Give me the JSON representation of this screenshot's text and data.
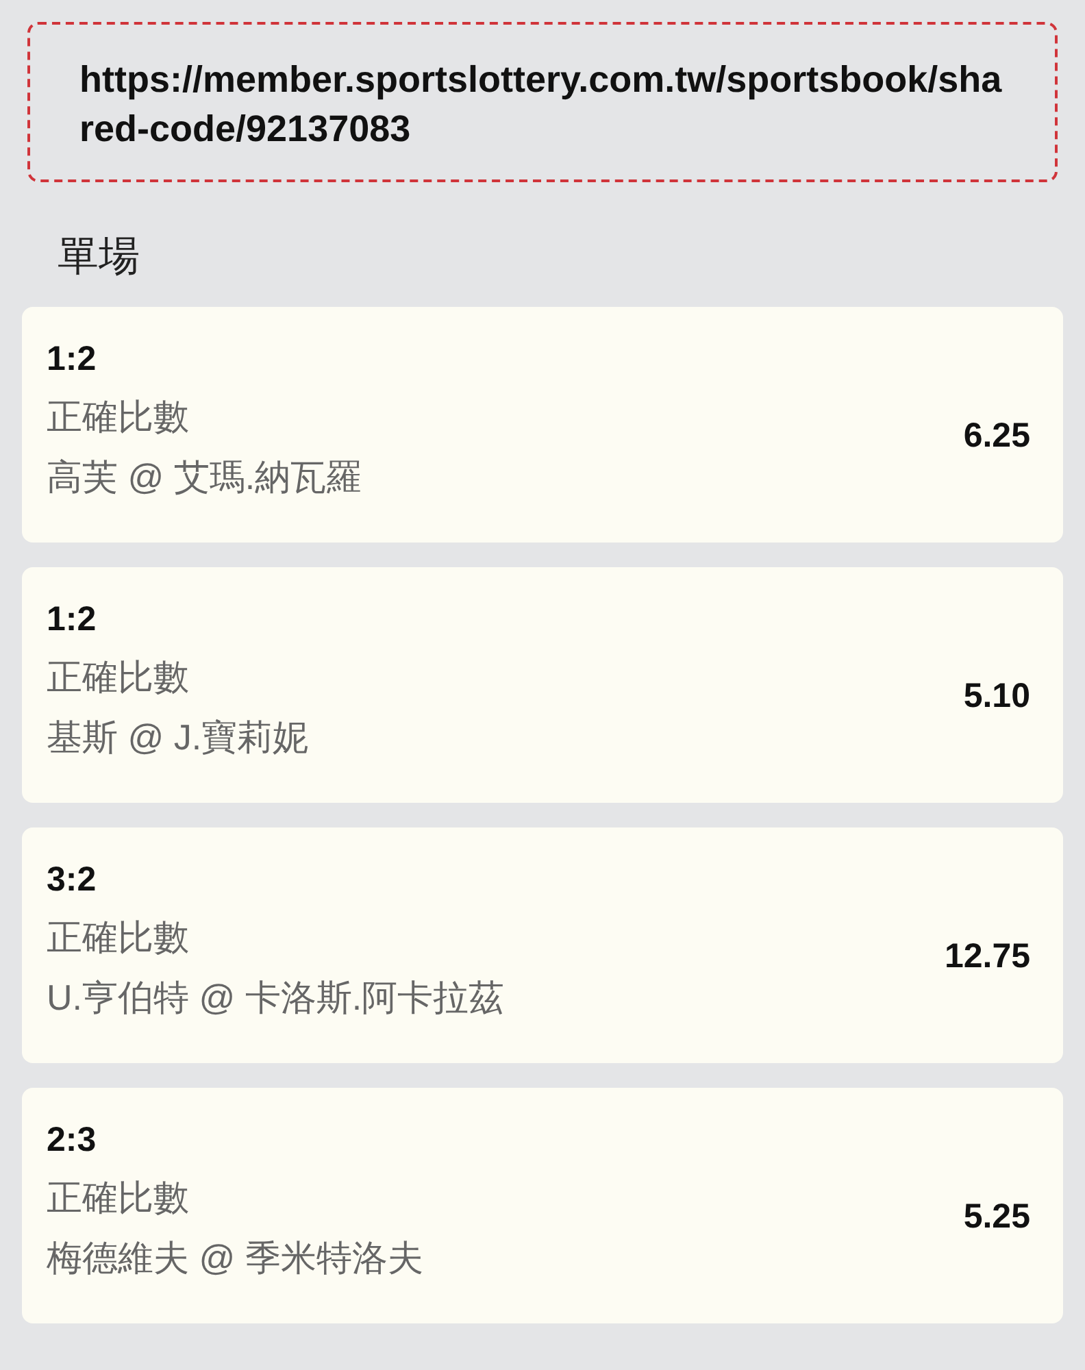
{
  "share_link": {
    "url": "https://member.sportslottery.com.tw/sportsbook/shared-code/92137083"
  },
  "section_title": "單場",
  "bets": [
    {
      "score": "1:2",
      "market": "正確比數",
      "match": "高芙 @ 艾瑪.納瓦羅",
      "odds": "6.25"
    },
    {
      "score": "1:2",
      "market": "正確比數",
      "match": "基斯 @ J.寶莉妮",
      "odds": "5.10"
    },
    {
      "score": "3:2",
      "market": "正確比數",
      "match": "U.亨伯特 @ 卡洛斯.阿卡拉茲",
      "odds": "12.75"
    },
    {
      "score": "2:3",
      "market": "正確比數",
      "match": "梅德維夫 @ 季米特洛夫",
      "odds": "5.25"
    }
  ]
}
